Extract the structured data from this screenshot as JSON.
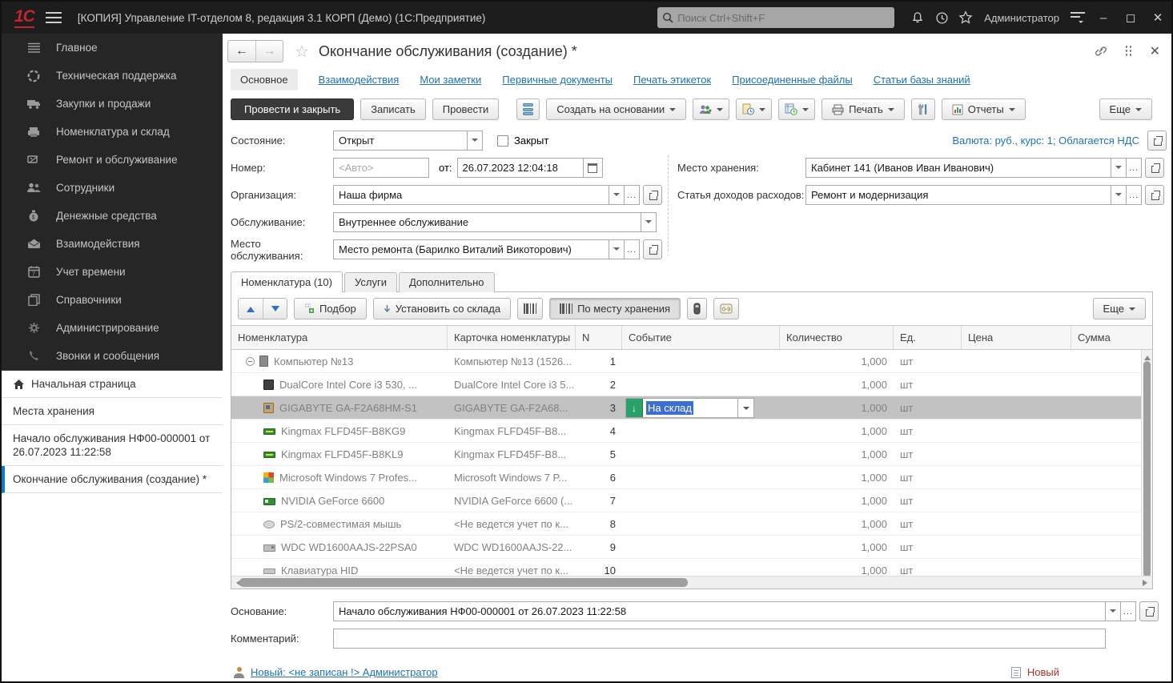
{
  "colors": {
    "accent_blue": "#1f71b8",
    "selection_blue": "#3b6fd1",
    "row_selected": "#c2c2c2",
    "event_green": "#2aa06b",
    "status_red": "#a8352a",
    "titlebar_bg": "#1d1d1d",
    "sidebar_bg": "#262626"
  },
  "titlebar": {
    "logo": "1С",
    "title": "[КОПИЯ] Управление IT-отделом 8, редакция 3.1 КОРП (Демо)  (1С:Предприятие)",
    "search_placeholder": "Поиск Ctrl+Shift+F",
    "user": "Администратор",
    "minimize": "–",
    "maximize": "◻",
    "close": "✕"
  },
  "sidebar": {
    "items": [
      {
        "label": "Главное",
        "icon": "menu-icon"
      },
      {
        "label": "Техническая поддержка",
        "icon": "support-icon"
      },
      {
        "label": "Закупки и продажи",
        "icon": "truck-icon"
      },
      {
        "label": "Номенклатура и склад",
        "icon": "warehouse-icon"
      },
      {
        "label": "Ремонт и обслуживание",
        "icon": "repair-icon"
      },
      {
        "label": "Сотрудники",
        "icon": "employees-icon"
      },
      {
        "label": "Денежные средства",
        "icon": "money-icon"
      },
      {
        "label": "Взаимодействия",
        "icon": "mail-icon"
      },
      {
        "label": "Учет времени",
        "icon": "time-icon"
      },
      {
        "label": "Справочники",
        "icon": "catalogs-icon"
      },
      {
        "label": "Администрирование",
        "icon": "gear-icon"
      },
      {
        "label": "Звонки и сообщения",
        "icon": "phone-icon"
      }
    ],
    "pages": {
      "home": "Начальная страница",
      "storage": "Места хранения",
      "begin_doc": "Начало обслуживания НФ00-000001 от 26.07.2023 11:22:58",
      "end_doc": "Окончание обслуживания (создание) *"
    }
  },
  "form": {
    "title": "Окончание обслуживания (создание) *",
    "tabs": {
      "main": "Основное",
      "interactions": "Взаимодействия",
      "notes": "Мои заметки",
      "primary_docs": "Первичные документы",
      "labels_print": "Печать этикеток",
      "attached": "Присоединенные файлы",
      "kb_articles": "Статьи базы знаний"
    },
    "toolbar": {
      "post_close": "Провести и закрыть",
      "save": "Записать",
      "post": "Провести",
      "create_based": "Создать на основании",
      "print": "Печать",
      "reports": "Отчеты",
      "more": "Еще"
    },
    "fields": {
      "state_label": "Состояние:",
      "state_value": "Открыт",
      "closed_label": "Закрыт",
      "number_label": "Номер:",
      "number_placeholder": "<Авто>",
      "date_label": "от:",
      "date_value": "26.07.2023 12:04:18",
      "org_label": "Организация:",
      "org_value": "Наша фирма",
      "service_label": "Обслуживание:",
      "service_value": "Внутреннее обслуживание",
      "place_label": "Место обслуживания:",
      "place_value": "Место ремонта (Барилко Виталий Викоторович)",
      "storage_label": "Место хранения:",
      "storage_value": "Кабинет 141 (Иванов Иван Иванович)",
      "expense_label": "Статья доходов расходов:",
      "expense_value": "Ремонт и модернизация",
      "currency_info": "Валюта: руб., курс: 1; Облагается НДС"
    }
  },
  "items": {
    "tabs": {
      "nomenclature": "Номенклатура (10)",
      "services": "Услуги",
      "additional": "Дополнительно"
    },
    "toolbar": {
      "pick": "Подбор",
      "set_from_stock": "Установить со склада",
      "by_storage": "По месту хранения",
      "more": "Еще"
    },
    "table": {
      "columns": [
        "Номенклатура",
        "Карточка номенклатуры",
        "N",
        "Событие",
        "Количество",
        "Ед.",
        "Цена",
        "Сумма"
      ],
      "rows": [
        {
          "icon": "computer-icon",
          "type": "computer",
          "expand": true,
          "level": 0,
          "name": "Компьютер №13",
          "card": "Компьютер №13 (1526...",
          "n": "1",
          "event": "",
          "qty": "1,000",
          "unit": "шт",
          "price": "",
          "sum": ""
        },
        {
          "icon": "cpu-icon",
          "type": "cpu",
          "expand": false,
          "level": 1,
          "name": "DualCore Intel Core i3 530, ...",
          "card": "DualCore Intel Core i3 5...",
          "n": "2",
          "event": "",
          "qty": "1,000",
          "unit": "шт",
          "price": "",
          "sum": ""
        },
        {
          "icon": "motherboard-icon",
          "type": "motherboard",
          "expand": false,
          "level": 1,
          "name": "GIGABYTE GA-F2A68HM-S1",
          "card": "GIGABYTE GA-F2A68...",
          "n": "3",
          "event": "На склад",
          "event_editing": true,
          "selected": true,
          "qty": "1,000",
          "unit": "шт",
          "price": "",
          "sum": ""
        },
        {
          "icon": "ram-icon",
          "type": "ram",
          "expand": false,
          "level": 1,
          "name": "Kingmax FLFD45F-B8KG9",
          "card": "Kingmax FLFD45F-B8...",
          "n": "4",
          "event": "",
          "qty": "1,000",
          "unit": "шт",
          "price": "",
          "sum": ""
        },
        {
          "icon": "ram-icon",
          "type": "ram",
          "expand": false,
          "level": 1,
          "name": "Kingmax FLFD45F-B8KL9",
          "card": "Kingmax FLFD45F-B8...",
          "n": "5",
          "event": "",
          "qty": "1,000",
          "unit": "шт",
          "price": "",
          "sum": ""
        },
        {
          "icon": "windows-icon",
          "type": "windows",
          "expand": false,
          "level": 1,
          "name": "Microsoft Windows 7 Profes...",
          "card": "Microsoft Windows 7 P...",
          "n": "6",
          "event": "",
          "qty": "1,000",
          "unit": "шт",
          "price": "",
          "sum": ""
        },
        {
          "icon": "gpu-icon",
          "type": "gpu",
          "expand": false,
          "level": 1,
          "name": "NVIDIA GeForce 6600",
          "card": "NVIDIA GeForce 6600 (...",
          "n": "7",
          "event": "",
          "qty": "1,000",
          "unit": "шт",
          "price": "",
          "sum": ""
        },
        {
          "icon": "mouse-icon",
          "type": "mouse",
          "expand": false,
          "level": 1,
          "name": "PS/2-совместимая мышь",
          "card": "<Не ведется учет по к...",
          "n": "8",
          "event": "",
          "qty": "1,000",
          "unit": "шт",
          "price": "",
          "sum": ""
        },
        {
          "icon": "hdd-icon",
          "type": "hdd",
          "expand": false,
          "level": 1,
          "name": "WDC WD1600AAJS-22PSA0",
          "card": "WDC WD1600AAJS-22...",
          "n": "9",
          "event": "",
          "qty": "1,000",
          "unit": "шт",
          "price": "",
          "sum": ""
        },
        {
          "icon": "keyboard-icon",
          "type": "keyboard",
          "expand": false,
          "level": 1,
          "name": "Клавиатура HID",
          "card": "<Не ведется учет по к...",
          "n": "10",
          "event": "",
          "qty": "1,000",
          "unit": "шт",
          "price": "",
          "sum": ""
        }
      ]
    }
  },
  "footer": {
    "basis_label": "Основание:",
    "basis_value": "Начало обслуживания НФ00-000001 от 26.07.2023 11:22:58",
    "comment_label": "Комментарий:",
    "status_link": "Новый: <не записан !> Администратор",
    "status_right": "Новый"
  }
}
